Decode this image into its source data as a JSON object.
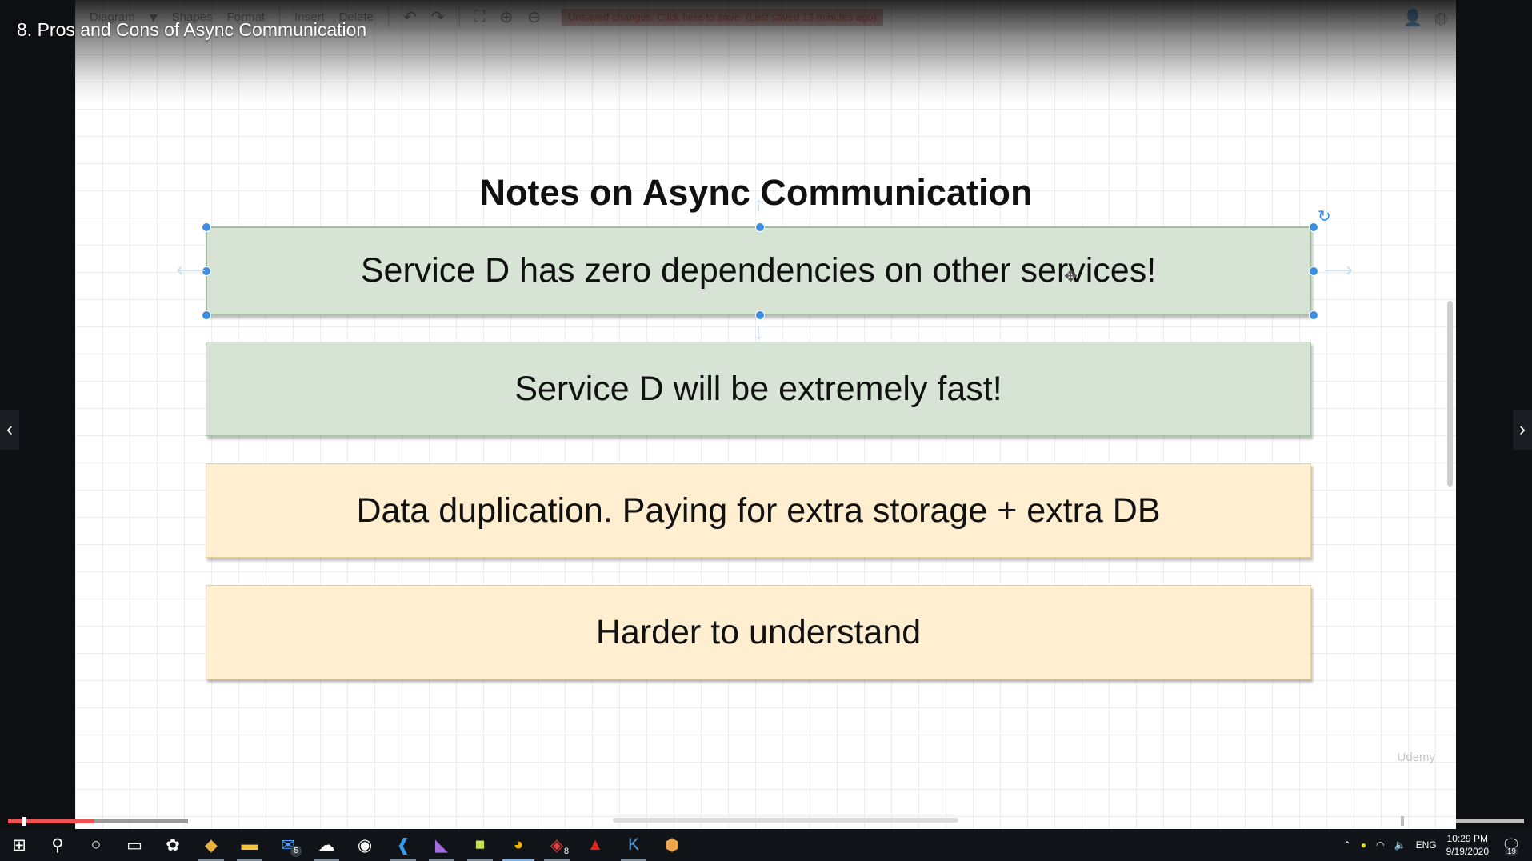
{
  "video": {
    "title": "8. Pros and Cons of Async Communication",
    "progress_percent": 8,
    "nav_prev_icon": "chevron-left-icon",
    "nav_next_icon": "chevron-right-icon"
  },
  "app_toolbar": {
    "diagram_menu": "Diagram",
    "shapes_label": "Shapes",
    "format_label": "Format",
    "insert_label": "Insert",
    "delete_label": "Delete",
    "unsaved_message": "Unsaved changes. Click here to save. (Last saved 13 minutes ago)"
  },
  "diagram": {
    "title": "Notes on Async Communication",
    "notes": [
      {
        "text": "Service D has zero dependencies on other services!",
        "color": "#d6e3d5"
      },
      {
        "text": "Service D will be extremely fast!",
        "color": "#d6e3d5"
      },
      {
        "text": "Data duplication.  Paying for extra storage + extra DB",
        "color": "#ffeecf"
      },
      {
        "text": "Harder to understand",
        "color": "#ffeecf"
      }
    ],
    "watermark": "Udemy"
  },
  "taskbar": {
    "mail_badge": "5",
    "chrome_badge": "8",
    "language": "ENG",
    "time": "10:29 PM",
    "date": "9/19/2020",
    "notification_count": "19"
  },
  "colors": {
    "progress": "#ec5252",
    "selection_handle": "#3b8ee0"
  }
}
